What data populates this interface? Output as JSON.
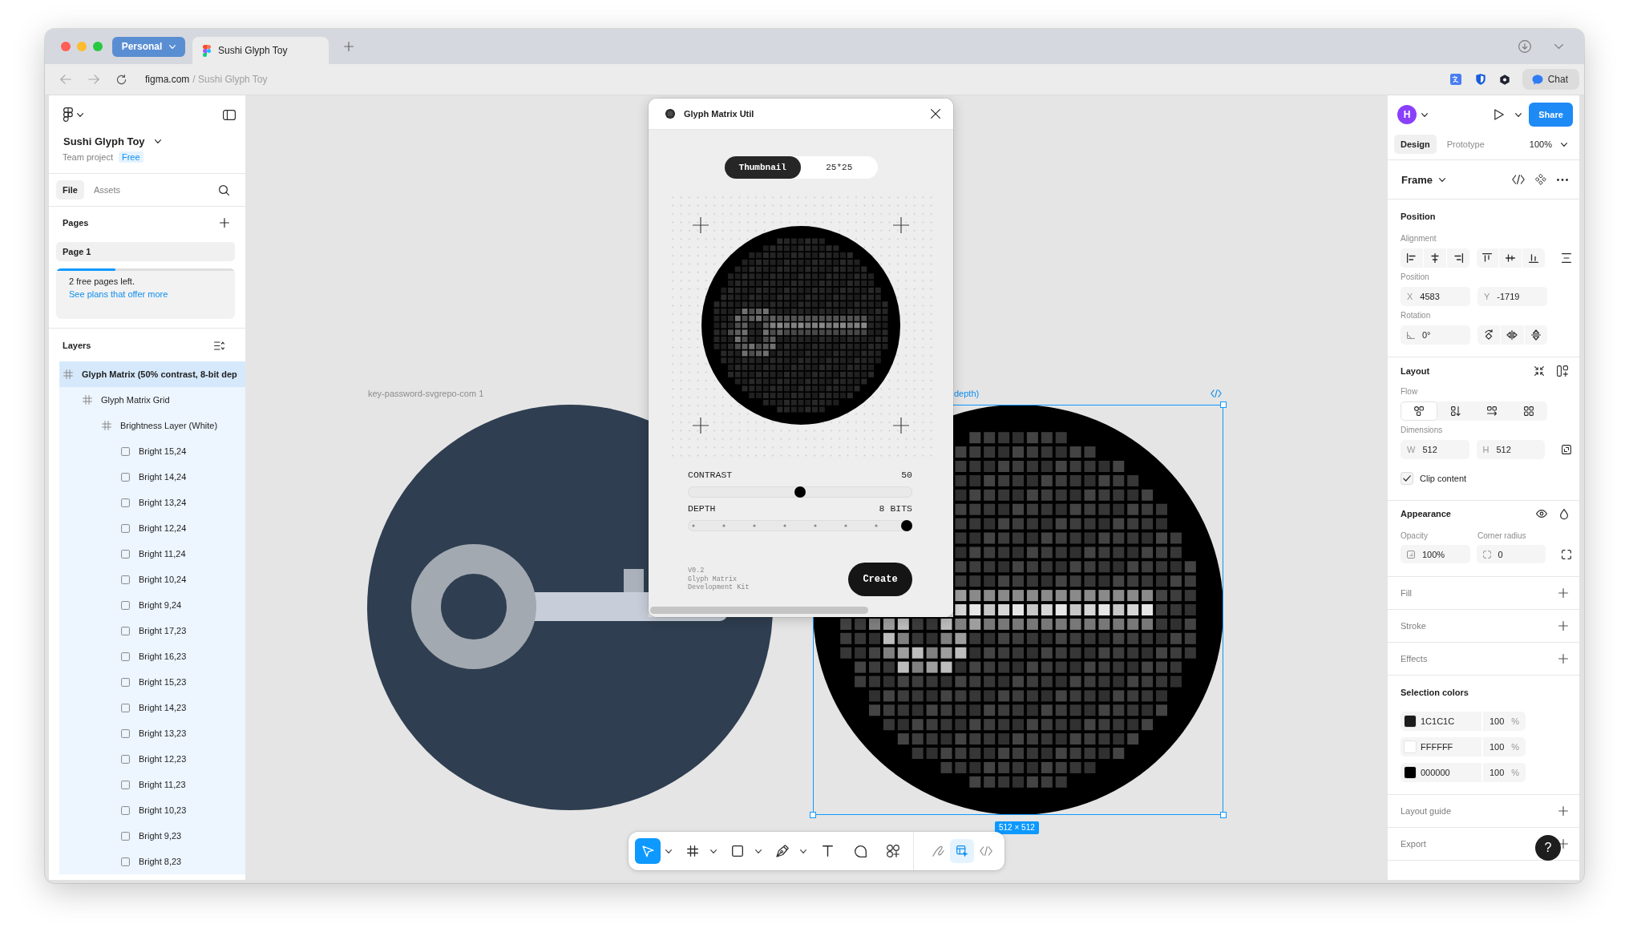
{
  "browser": {
    "profile": "Personal",
    "tabs": [
      {
        "title": "Sushi Glyph Toy",
        "selected": true
      }
    ],
    "address": {
      "host": "figma.com",
      "path": "/ Sushi Glyph Toy"
    },
    "chat": "Chat"
  },
  "file": {
    "name": "Sushi Glyph Toy",
    "project": "Team project",
    "plan": "Free"
  },
  "left_tabs": [
    {
      "label": "File",
      "selected": true
    },
    {
      "label": "Assets",
      "selected": false
    }
  ],
  "pages": {
    "title": "Pages",
    "items": [
      {
        "label": "Page 1",
        "selected": true
      }
    ],
    "usage": {
      "level": 0.33,
      "message": "2 free pages left.",
      "link": "See plans that offer more"
    }
  },
  "layers": {
    "title": "Layers",
    "tree": [
      {
        "name": "Glyph Matrix (50% contrast, 8-bit dep",
        "kind": "frame",
        "selected": true,
        "children": [
          {
            "name": "Glyph Matrix Grid",
            "kind": "frame",
            "selected": false,
            "children": [
              {
                "name": "Brightness Layer (White)",
                "kind": "frame",
                "selected": false,
                "children": [
                  {
                    "name": "Bright 15,24",
                    "kind": "rectangle",
                    "selected": false
                  },
                  {
                    "name": "Bright 14,24",
                    "kind": "rectangle",
                    "selected": false
                  },
                  {
                    "name": "Bright 13,24",
                    "kind": "rectangle",
                    "selected": false
                  },
                  {
                    "name": "Bright 12,24",
                    "kind": "rectangle",
                    "selected": false
                  },
                  {
                    "name": "Bright 11,24",
                    "kind": "rectangle",
                    "selected": false
                  },
                  {
                    "name": "Bright 10,24",
                    "kind": "rectangle",
                    "selected": false
                  },
                  {
                    "name": "Bright 9,24",
                    "kind": "rectangle",
                    "selected": false
                  },
                  {
                    "name": "Bright 17,23",
                    "kind": "rectangle",
                    "selected": false
                  },
                  {
                    "name": "Bright 16,23",
                    "kind": "rectangle",
                    "selected": false
                  },
                  {
                    "name": "Bright 15,23",
                    "kind": "rectangle",
                    "selected": false
                  },
                  {
                    "name": "Bright 14,23",
                    "kind": "rectangle",
                    "selected": false
                  },
                  {
                    "name": "Bright 13,23",
                    "kind": "rectangle",
                    "selected": false
                  },
                  {
                    "name": "Bright 12,23",
                    "kind": "rectangle",
                    "selected": false
                  },
                  {
                    "name": "Bright 11,23",
                    "kind": "rectangle",
                    "selected": false
                  },
                  {
                    "name": "Bright 10,23",
                    "kind": "rectangle",
                    "selected": false
                  },
                  {
                    "name": "Bright 9,23",
                    "kind": "rectangle",
                    "selected": false
                  },
                  {
                    "name": "Bright 8,23",
                    "kind": "rectangle",
                    "selected": false
                  }
                ]
              }
            ]
          }
        ]
      }
    ]
  },
  "canvas": {
    "image": {
      "label": "key-password-svgrepo-com 1"
    },
    "frame": {
      "label": "depth)",
      "size": "512 × 512",
      "selected": true
    }
  },
  "plugin": {
    "title": "Glyph Matrix Util",
    "modes": [
      {
        "label": "Thumbnail",
        "selected": true
      },
      {
        "label": "25*25",
        "selected": false
      }
    ],
    "controls": [
      {
        "kind": "continuous",
        "label": "CONTRAST",
        "reading": "50",
        "level": 0.5
      },
      {
        "kind": "stepped",
        "label": "DEPTH",
        "reading": "8 BITS",
        "level": 1
      }
    ],
    "note": [
      "V0.2",
      "Glyph Matrix",
      "Development Kit"
    ],
    "create": "Create"
  },
  "toolbar": {
    "tools": [
      {
        "kind": "move",
        "selected": true,
        "menu": true
      },
      {
        "kind": "frame",
        "selected": false,
        "menu": true
      },
      {
        "kind": "rectangle",
        "selected": false,
        "menu": true
      },
      {
        "kind": "pen",
        "selected": false,
        "menu": true
      },
      {
        "kind": "text",
        "selected": false,
        "menu": false
      },
      {
        "kind": "comment",
        "selected": false,
        "menu": false
      },
      {
        "kind": "actions",
        "selected": false,
        "menu": false
      }
    ],
    "modes": [
      {
        "kind": "draw",
        "selected": false
      },
      {
        "kind": "design",
        "selected": true
      },
      {
        "kind": "dev",
        "selected": false
      }
    ]
  },
  "design_panel": {
    "avatar": "H",
    "share": "Share",
    "tabs": [
      {
        "label": "Design",
        "selected": true
      },
      {
        "label": "Prototype",
        "selected": false
      }
    ],
    "zoom": "100%",
    "selection": "Frame",
    "position": {
      "title": "Position",
      "alignment": "Alignment",
      "position": "Position",
      "fields": [
        {
          "label": "X",
          "value": "4583"
        },
        {
          "label": "Y",
          "value": "-1719"
        }
      ],
      "rotation": "Rotation",
      "rotation_value": "0°"
    },
    "layout": {
      "title": "Layout",
      "flow": "Flow",
      "flow_options": [
        {
          "kind": "freeform",
          "selected": true
        },
        {
          "kind": "vertical",
          "selected": false
        },
        {
          "kind": "horizontal",
          "selected": false
        },
        {
          "kind": "grid",
          "selected": false
        }
      ],
      "dimensions": "Dimensions",
      "fields": [
        {
          "label": "W",
          "value": "512"
        },
        {
          "label": "H",
          "value": "512"
        }
      ],
      "clip": {
        "label": "Clip content",
        "checked": true
      }
    },
    "appearance": {
      "title": "Appearance",
      "opacity_label": "Opacity",
      "opacity": "100%",
      "radius_label": "Corner radius",
      "radius": "0"
    },
    "sections": [
      {
        "kind": "add",
        "title": "Fill"
      },
      {
        "kind": "add",
        "title": "Stroke"
      },
      {
        "kind": "add",
        "title": "Effects"
      },
      {
        "kind": "colors",
        "title": "Selection colors",
        "colors": [
          {
            "hex": "1C1C1C",
            "color": "#1c1c1c",
            "opacity": "100",
            "unit": "%"
          },
          {
            "hex": "FFFFFF",
            "color": "#ffffff",
            "opacity": "100",
            "unit": "%"
          },
          {
            "hex": "000000",
            "color": "#000000",
            "opacity": "100",
            "unit": "%"
          }
        ]
      },
      {
        "kind": "add",
        "title": "Layout guide"
      },
      {
        "kind": "add",
        "title": "Export"
      }
    ],
    "help": "?"
  }
}
